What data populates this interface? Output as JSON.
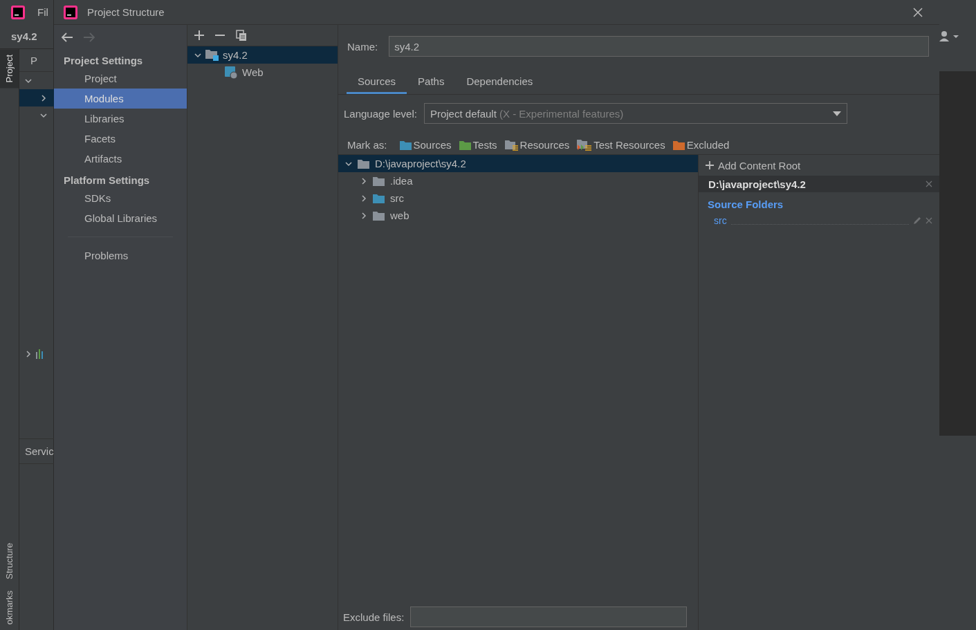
{
  "ide": {
    "menu": "Fil",
    "breadcrumb": "sy4.2",
    "panel_label": "P",
    "services_label": "Servic",
    "tool_tabs_top": [
      {
        "label": "Project",
        "selected": true
      }
    ],
    "tool_tabs_bottom": [
      {
        "label": "Structure",
        "selected": false
      },
      {
        "label": "okmarks",
        "selected": false
      }
    ]
  },
  "dialog": {
    "title": "Project Structure"
  },
  "sidebar": {
    "sections": [
      {
        "heading": "Project Settings",
        "items": [
          {
            "label": "Project",
            "selected": false
          },
          {
            "label": "Modules",
            "selected": true
          },
          {
            "label": "Libraries",
            "selected": false
          },
          {
            "label": "Facets",
            "selected": false
          },
          {
            "label": "Artifacts",
            "selected": false
          }
        ]
      },
      {
        "heading": "Platform Settings",
        "items": [
          {
            "label": "SDKs",
            "selected": false
          },
          {
            "label": "Global Libraries",
            "selected": false
          }
        ]
      }
    ],
    "extra_items": [
      {
        "label": "Problems",
        "selected": false
      }
    ]
  },
  "module_tree": [
    {
      "label": "sy4.2",
      "kind": "module",
      "selected": true,
      "expanded": true,
      "children": [
        {
          "label": "Web",
          "kind": "web",
          "selected": false
        }
      ]
    }
  ],
  "name_field": {
    "label": "Name:",
    "value": "sy4.2"
  },
  "tabs": [
    {
      "label": "Sources",
      "selected": true
    },
    {
      "label": "Paths",
      "selected": false
    },
    {
      "label": "Dependencies",
      "selected": false
    }
  ],
  "language_level": {
    "label": "Language level:",
    "value": "Project default",
    "hint": "(X - Experimental features)"
  },
  "mark_as": {
    "label": "Mark as:",
    "options": [
      {
        "label": "Sources",
        "kind": "folder",
        "color": "#3d8fb5"
      },
      {
        "label": "Tests",
        "kind": "folder",
        "color": "#5c9a46"
      },
      {
        "label": "Resources",
        "kind": "resource",
        "color": "#8a9199"
      },
      {
        "label": "Test Resources",
        "kind": "test-resource",
        "color": "#8a9199"
      },
      {
        "label": "Excluded",
        "kind": "folder",
        "color": "#d06a2c"
      }
    ]
  },
  "content_tree": [
    {
      "label": "D:\\javaproject\\sy4.2",
      "kind": "plain",
      "selected": true,
      "expanded": true,
      "children": [
        {
          "label": ".idea",
          "kind": "plain",
          "selected": false,
          "expanded": false
        },
        {
          "label": "src",
          "kind": "source",
          "selected": false,
          "expanded": false
        },
        {
          "label": "web",
          "kind": "plain",
          "selected": false,
          "expanded": false
        }
      ]
    }
  ],
  "content_root": {
    "add_label": "Add Content Root",
    "path": "D:\\javaproject\\sy4.2",
    "section": "Source Folders",
    "source_folders": [
      "src"
    ]
  },
  "exclude_files": {
    "label": "Exclude files:"
  }
}
